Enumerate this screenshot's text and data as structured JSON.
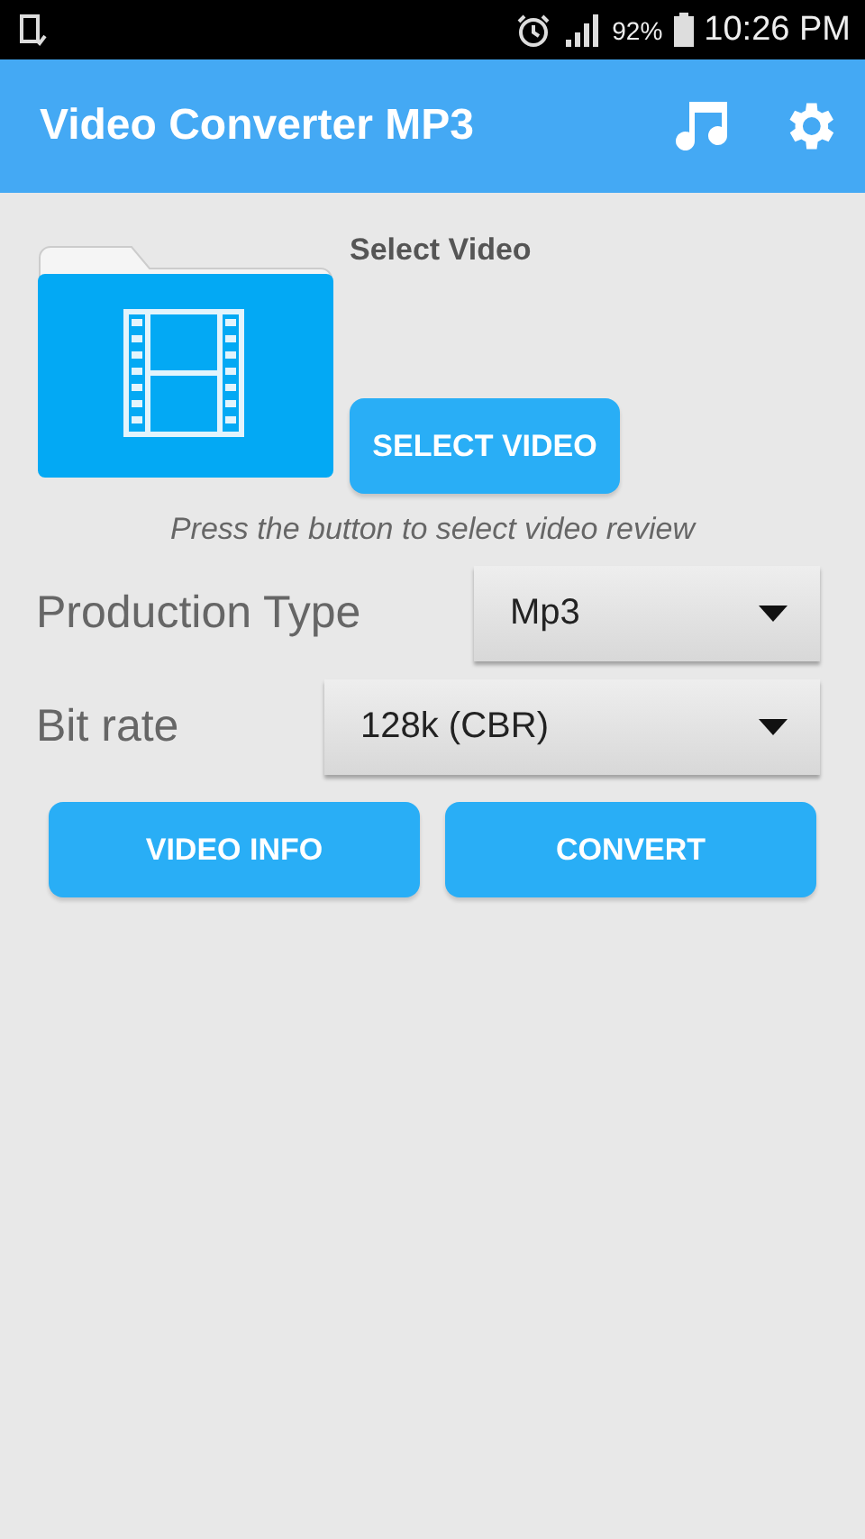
{
  "status_bar": {
    "battery": "92%",
    "time": "10:26 PM"
  },
  "app_bar": {
    "title": "Video Converter MP3"
  },
  "picker": {
    "label": "Select Video",
    "button": "SELECT VIDEO",
    "hint": "Press the button to select video review"
  },
  "settings": [
    {
      "label": "Production Type",
      "value": "Mp3"
    },
    {
      "label": "Bit rate",
      "value": "128k (CBR)"
    }
  ],
  "actions": [
    "VIDEO INFO",
    "CONVERT"
  ]
}
